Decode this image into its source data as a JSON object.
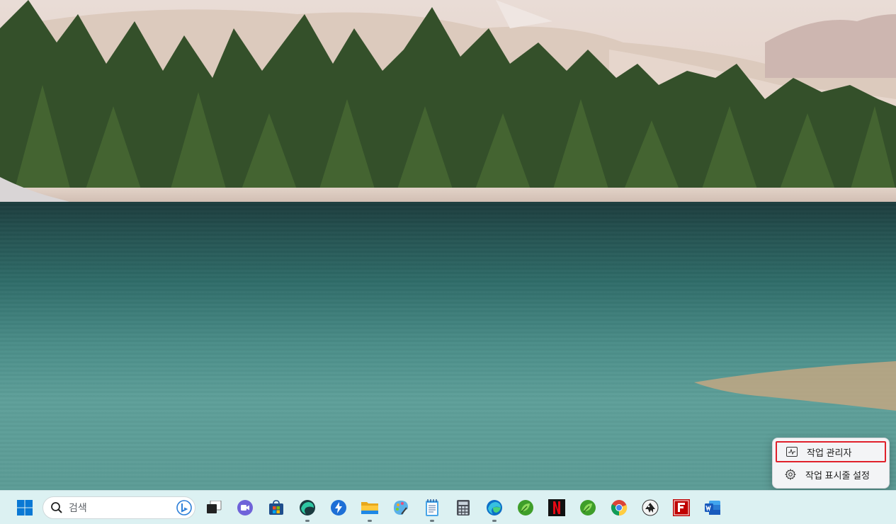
{
  "context_menu": {
    "items": [
      {
        "label": "작업 관리자",
        "icon": "task-manager-icon"
      },
      {
        "label": "작업 표시줄 설정",
        "icon": "gear-icon"
      }
    ]
  },
  "taskbar": {
    "search": {
      "placeholder": "검색"
    },
    "apps": [
      {
        "name": "start-button",
        "icon": "windows-logo-icon"
      },
      {
        "name": "task-view-button",
        "icon": "task-view-icon"
      },
      {
        "name": "zoom-app",
        "icon": "video-chat-icon"
      },
      {
        "name": "microsoft-store-app",
        "icon": "store-icon"
      },
      {
        "name": "edge-dev-app",
        "icon": "edge-dev-icon"
      },
      {
        "name": "quick-assist-app",
        "icon": "lightning-icon"
      },
      {
        "name": "file-explorer-app",
        "icon": "folder-icon"
      },
      {
        "name": "paint-app",
        "icon": "palette-icon"
      },
      {
        "name": "notepad-app",
        "icon": "notepad-icon"
      },
      {
        "name": "calculator-app",
        "icon": "calculator-icon"
      },
      {
        "name": "edge-app",
        "icon": "edge-icon"
      },
      {
        "name": "green-app-1",
        "icon": "leaf-icon"
      },
      {
        "name": "netflix-app",
        "icon": "netflix-icon"
      },
      {
        "name": "green-app-2",
        "icon": "leaf-icon"
      },
      {
        "name": "chrome-app",
        "icon": "chrome-icon"
      },
      {
        "name": "inkscape-app",
        "icon": "inkscape-icon"
      },
      {
        "name": "filezilla-app",
        "icon": "filezilla-icon"
      },
      {
        "name": "word-app",
        "icon": "word-icon"
      }
    ]
  }
}
